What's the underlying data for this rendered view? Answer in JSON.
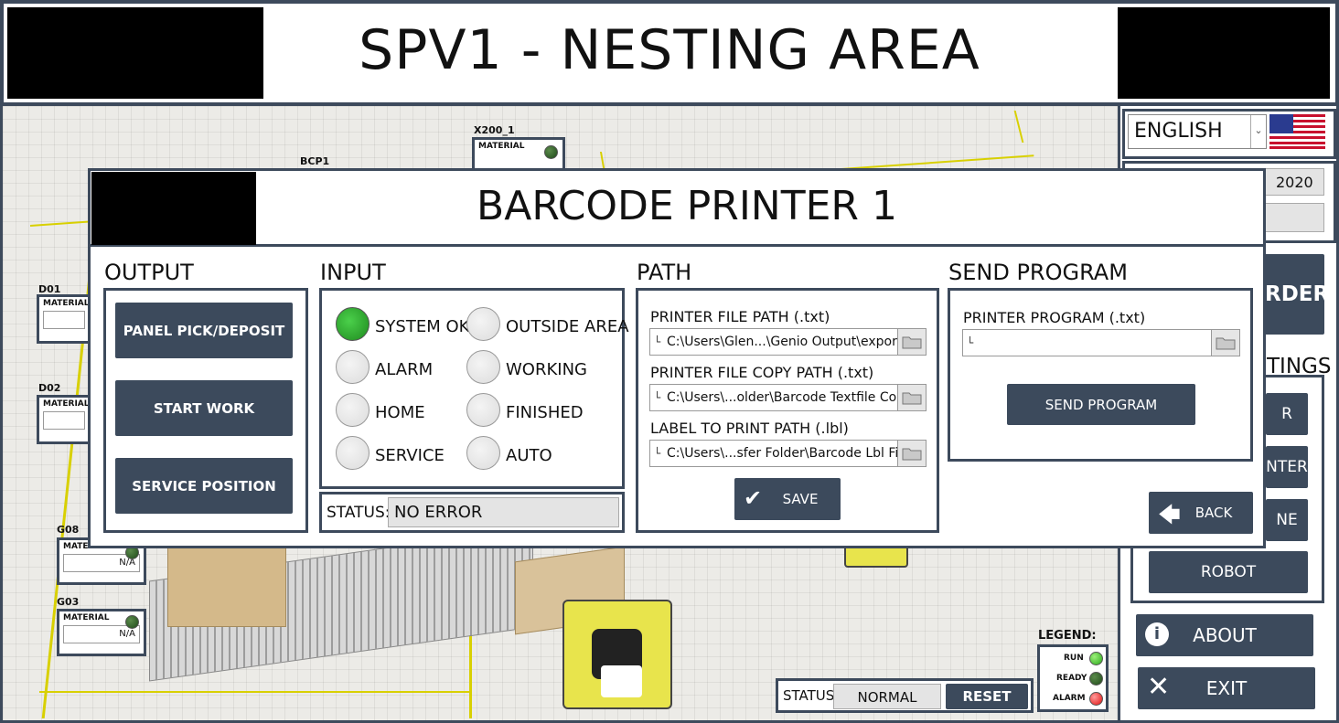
{
  "header": {
    "title": "SPV1 - NESTING AREA"
  },
  "scene": {
    "stations": [
      {
        "tag": "X200_1",
        "material_label": "MATERIAL"
      },
      {
        "tag": "BCP1"
      },
      {
        "tag": "D01",
        "material_label": "MATERIAL"
      },
      {
        "tag": "D02",
        "material_label": "MATERIAL"
      },
      {
        "tag": "G08",
        "material_label": "MATERIAL",
        "value": "N/A"
      },
      {
        "tag": "G03",
        "material_label": "MATERIAL",
        "value": "N/A"
      }
    ],
    "status": {
      "label": "STATUS:",
      "value": "NORMAL",
      "reset_label": "RESET"
    },
    "legend": {
      "title": "LEGEND:",
      "items": [
        "RUN",
        "READY",
        "ALARM"
      ]
    }
  },
  "right_panel": {
    "language": "ENGLISH",
    "date_partial": "2020",
    "order_partial": "RDER",
    "settings_partial": "TINGS",
    "btn_partials": [
      "R",
      "NTER",
      "NE"
    ],
    "robot_label": "ROBOT",
    "about_label": "ABOUT",
    "exit_label": "EXIT"
  },
  "dialog": {
    "title": "BARCODE PRINTER 1",
    "output": {
      "title": "OUTPUT",
      "buttons": [
        "PANEL PICK/DEPOSIT",
        "START WORK",
        "SERVICE POSITION"
      ]
    },
    "input": {
      "title": "INPUT",
      "indicators": [
        {
          "label": "SYSTEM OK",
          "on": true
        },
        {
          "label": "OUTSIDE AREA",
          "on": false
        },
        {
          "label": "ALARM",
          "on": false
        },
        {
          "label": "WORKING",
          "on": false
        },
        {
          "label": "HOME",
          "on": false
        },
        {
          "label": "FINISHED",
          "on": false
        },
        {
          "label": "SERVICE",
          "on": false
        },
        {
          "label": "AUTO",
          "on": false
        }
      ],
      "status_label": "STATUS:",
      "status_value": "NO ERROR"
    },
    "path": {
      "title": "PATH",
      "fields": [
        {
          "label": "PRINTER FILE PATH (.txt)",
          "value": "C:\\Users\\Glen...\\Genio Output\\export"
        },
        {
          "label": "PRINTER FILE COPY PATH (.txt)",
          "value": "C:\\Users\\...older\\Barcode Textfile Copy"
        },
        {
          "label": "LABEL TO PRINT PATH (.lbl)",
          "value": "C:\\Users\\...sfer Folder\\Barcode Lbl File"
        }
      ],
      "save_label": "SAVE"
    },
    "send_program": {
      "title": "SEND PROGRAM",
      "field_label": "PRINTER PROGRAM (.txt)",
      "field_value": "",
      "button_label": "SEND PROGRAM"
    },
    "back_label": "BACK"
  }
}
